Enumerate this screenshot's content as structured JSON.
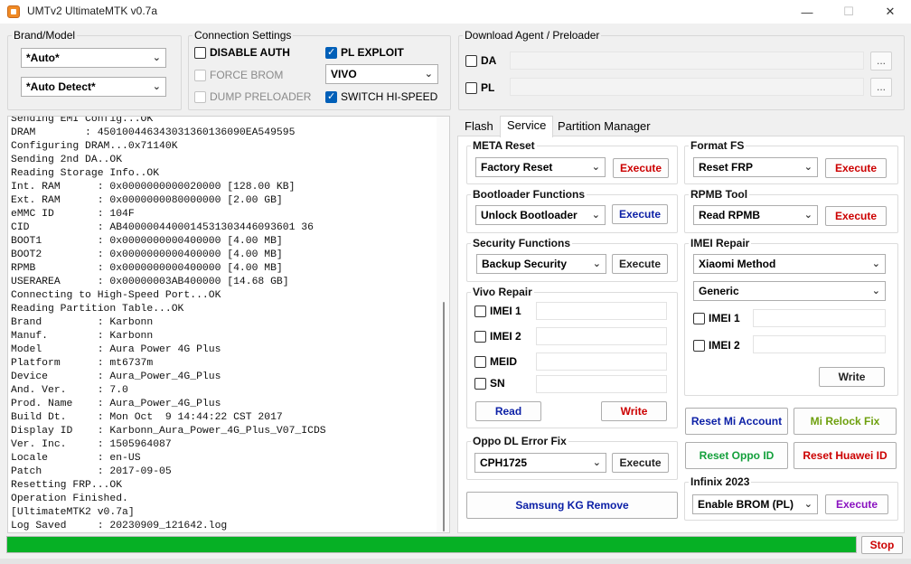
{
  "window": {
    "title": "UMTv2 UltimateMTK v0.7a",
    "controls": [
      "—",
      "☐",
      "✕"
    ]
  },
  "brand_model": {
    "legend": "Brand/Model",
    "brand_selected": "*Auto*",
    "model_selected": "*Auto Detect*"
  },
  "connection": {
    "legend": "Connection Settings",
    "disable_auth": {
      "label": "DISABLE AUTH",
      "checked": false
    },
    "force_brom": {
      "label": "FORCE BROM",
      "checked": false,
      "enabled": false
    },
    "dump_preloader": {
      "label": "DUMP PRELOADER",
      "checked": false,
      "enabled": false
    },
    "pl_exploit": {
      "label": "PL EXPLOIT",
      "checked": true
    },
    "exploit_vendor": "VIVO",
    "switch_hispeed": {
      "label": "SWITCH HI-SPEED",
      "checked": true
    }
  },
  "download_agent": {
    "legend": "Download Agent / Preloader",
    "da_label": "DA",
    "pl_label": "PL",
    "browse_label": "..."
  },
  "log": [
    "Sending EMI Config...OK",
    "DRAM        : 450100446343031360136090EA549595",
    "Configuring DRAM...0x71140K",
    "Sending 2nd DA..OK",
    "Reading Storage Info..OK",
    "Int. RAM      : 0x0000000000020000 [128.00 KB]",
    "Ext. RAM      : 0x0000000080000000 [2.00 GB]",
    "eMMC ID       : 104F",
    "CID           : AB4000004400014531303446093601 36",
    "BOOT1         : 0x0000000000400000 [4.00 MB]",
    "BOOT2         : 0x0000000000400000 [4.00 MB]",
    "RPMB          : 0x0000000000400000 [4.00 MB]",
    "USERAREA      : 0x00000003AB400000 [14.68 GB]",
    "Connecting to High-Speed Port...OK",
    "Reading Partition Table...OK",
    "Brand         : Karbonn",
    "Manuf.        : Karbonn",
    "Model         : Aura Power 4G Plus",
    "Platform      : mt6737m",
    "Device        : Aura_Power_4G_Plus",
    "And. Ver.     : 7.0",
    "Prod. Name    : Aura_Power_4G_Plus",
    "Build Dt.     : Mon Oct  9 14:44:22 CST 2017",
    "Display ID    : Karbonn_Aura_Power_4G_Plus_V07_ICDS",
    "Ver. Inc.     : 1505964087",
    "Locale        : en-US",
    "Patch         : 2017-09-05",
    "Resetting FRP...OK",
    "Operation Finished.",
    "[UltimateMTK2 v0.7a]",
    "Log Saved     : 20230909_121642.log"
  ],
  "tabs": [
    "Flash",
    "Service",
    "Partition Manager"
  ],
  "active_tab": "Service",
  "service": {
    "meta_reset": {
      "legend": "META Reset",
      "selected": "Factory Reset",
      "button": "Execute"
    },
    "bootloader": {
      "legend": "Bootloader Functions",
      "selected": "Unlock Bootloader",
      "button": "Execute"
    },
    "security": {
      "legend": "Security Functions",
      "selected": "Backup Security",
      "button": "Execute"
    },
    "vivo": {
      "legend": "Vivo Repair",
      "imei1": "IMEI 1",
      "imei2": "IMEI 2",
      "meid": "MEID",
      "sn": "SN",
      "read": "Read",
      "write": "Write"
    },
    "oppo": {
      "legend": "Oppo DL Error Fix",
      "selected": "CPH1725",
      "button": "Execute"
    },
    "samsung_kg": "Samsung KG Remove",
    "format_fs": {
      "legend": "Format FS",
      "selected": "Reset FRP",
      "button": "Execute"
    },
    "rpmb": {
      "legend": "RPMB Tool",
      "selected": "Read RPMB",
      "button": "Execute"
    },
    "imei_repair": {
      "legend": "IMEI Repair",
      "method": "Xiaomi Method",
      "mode": "Generic",
      "imei1": "IMEI 1",
      "imei2": "IMEI 2",
      "write": "Write"
    },
    "reset_mi": "Reset Mi Account",
    "mi_relock": "Mi Relock Fix",
    "reset_oppo": "Reset Oppo ID",
    "reset_huawei": "Reset Huawei ID",
    "infinix": {
      "legend": "Infinix 2023",
      "selected": "Enable BROM (PL)",
      "button": "Execute"
    }
  },
  "progress": {
    "percent": 100,
    "color": "#06b025"
  },
  "stop_label": "Stop",
  "colors": {
    "execute_red": "#cc0000",
    "execute_navy": "#0b1fa6",
    "green": "#14a03c",
    "purple": "#8a12c0"
  }
}
